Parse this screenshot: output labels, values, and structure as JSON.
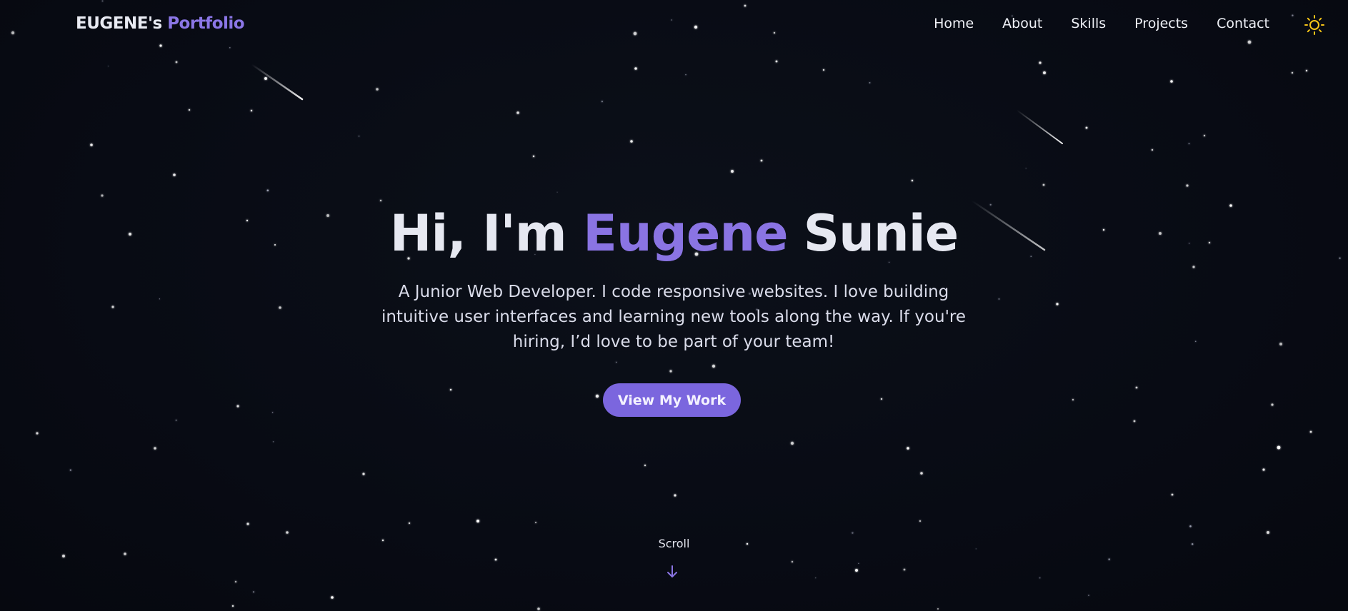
{
  "header": {
    "brand_main": "EUGENE's",
    "brand_accent": "Portfolio",
    "nav": [
      {
        "label": "Home"
      },
      {
        "label": "About"
      },
      {
        "label": "Skills"
      },
      {
        "label": "Projects"
      },
      {
        "label": "Contact"
      }
    ],
    "theme_toggle_icon": "sun-icon"
  },
  "hero": {
    "greeting": "Hi, I'm",
    "first_name": "Eugene",
    "last_name": "Sunie",
    "description": "A Junior Web Developer. I code responsive websites. I love building intuitive user interfaces and learning new tools along the way. If you're hiring, I’d love to be part of your team!",
    "cta_label": "View My Work"
  },
  "scroll": {
    "label": "Scroll",
    "icon": "arrow-down-icon"
  },
  "colors": {
    "background": "#080b14",
    "accent": "#8a74e3",
    "button": "#7b66de",
    "sun": "#f5c518"
  }
}
